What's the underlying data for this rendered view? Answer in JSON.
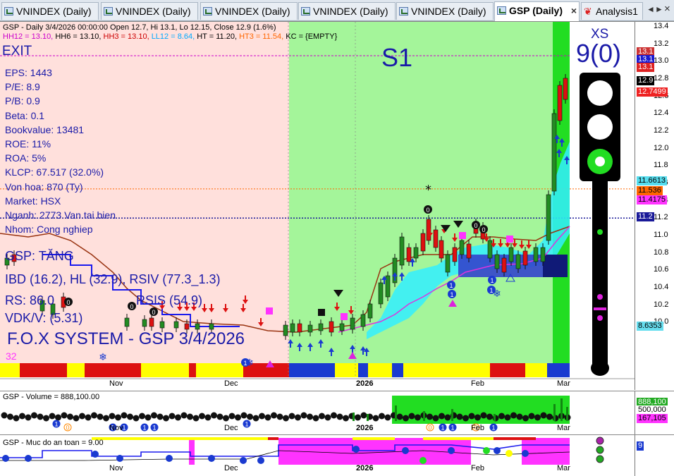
{
  "tabs": [
    {
      "label": "VNINDEX (Daily)",
      "active": false
    },
    {
      "label": "VNINDEX (Daily)",
      "active": false
    },
    {
      "label": "VNINDEX (Daily)",
      "active": false
    },
    {
      "label": "VNINDEX (Daily)",
      "active": false
    },
    {
      "label": "VNINDEX (Daily)",
      "active": false
    },
    {
      "label": "GSP (Daily)",
      "active": true,
      "close": "×"
    },
    {
      "label": "Analysis1",
      "active": false
    }
  ],
  "tab_nav": {
    "prev": "◄",
    "next": "►",
    "close": "×"
  },
  "price_panel": {
    "header_line1": "GSP - Daily 3/4/2026 00:00:00 Open 12.7, Hi 13.1, Lo 12.15, Close 12.9 (1.6%)",
    "header_line2": [
      {
        "text": "HH12 = 13.10,",
        "color": "#cc00cc"
      },
      {
        "text": "HH6 = 13.10,",
        "color": "#000000"
      },
      {
        "text": "HH3 = 13.10,",
        "color": "#cc0000"
      },
      {
        "text": "LL12 = 8.64,",
        "color": "#00aaff"
      },
      {
        "text": "HT = 11.20,",
        "color": "#000000"
      },
      {
        "text": "HT3 = 11.54,",
        "color": "#ff6600"
      },
      {
        "text": "KC = {EMPTY}",
        "color": "#000000"
      }
    ],
    "exit_label": "EXIT",
    "s1_label": "S1",
    "fundamentals": [
      "EPS: 1443",
      "P/E: 8.9",
      "P/B: 0.9",
      "Beta: 0.1",
      "Bookvalue: 13481",
      "ROE: 11%",
      "ROA: 5%",
      "KLCP: 67.517 (32.0%)",
      "Von hoa: 870 (Ty)",
      "Market: HSX",
      "Nganh: 2773 Van tai bien",
      "Nhom: Cong nghiep"
    ],
    "status": "GSP: TĂNG",
    "ibd_line": "IBD (16.2), HL (32.9), RSIV (77.3_1.3)",
    "rs": "RS: 86.0",
    "rsis": "RSIS (54.9)",
    "vdk": "VDK/V:  (5.31)",
    "footer_title": "F.O.X SYSTEM - GSP 3/4/2026",
    "bar_count": "32",
    "xs_label": "XS",
    "score": "9(0)",
    "y_ticks": [
      "13.4",
      "13.2",
      "13.0",
      "12.8",
      "12.6",
      "12.4",
      "12.2",
      "12.0",
      "11.8",
      "11.6",
      "11.4",
      "11.2",
      "11.0",
      "10.8",
      "10.6",
      "10.4",
      "10.2",
      "10.0"
    ],
    "price_tags": [
      {
        "text": "13.1",
        "bg": "#cc3333",
        "fg": "#ffffff",
        "v": 13.12
      },
      {
        "text": "13.1",
        "bg": "#1a1ad0",
        "fg": "#ffffff",
        "v": 13.03
      },
      {
        "text": "13.1",
        "bg": "#dd2222",
        "fg": "#ffffff",
        "v": 12.94
      },
      {
        "text": "12.9",
        "bg": "#000000",
        "fg": "#ffffff",
        "v": 12.78
      },
      {
        "text": "12.7499",
        "bg": "#ee2222",
        "fg": "#ffffff",
        "v": 12.65
      },
      {
        "text": "11.6613",
        "bg": "#55ddee",
        "fg": "#000000",
        "v": 11.63
      },
      {
        "text": "11.536",
        "bg": "#ff6600",
        "fg": "#000000",
        "v": 11.52
      },
      {
        "text": "11.4175",
        "bg": "#ff33ff",
        "fg": "#000000",
        "v": 11.41
      },
      {
        "text": "11.2",
        "bg": "#1a1a99",
        "fg": "#ffffff",
        "v": 11.22
      },
      {
        "text": "8.6353",
        "bg": "#66ddee",
        "fg": "#000000",
        "v": 9.96
      }
    ],
    "x_dates": [
      "Nov",
      "Dec",
      "2026",
      "Feb",
      "Mar"
    ]
  },
  "volume_panel": {
    "header": "GSP - Volume = 888,100.00",
    "tags": [
      {
        "text": "888,100",
        "bg": "#22aa22",
        "fg": "#ffffff"
      },
      {
        "text": "500,000",
        "bg": "#ffffff",
        "fg": "#000000"
      },
      {
        "text": "167,105",
        "bg": "#ff33ff",
        "fg": "#000000"
      }
    ],
    "x_dates": [
      "Nov",
      "Dec",
      "2026",
      "Feb",
      "Mar"
    ]
  },
  "safety_panel": {
    "header": "GSP - Muc do an toan = 9.00",
    "tag": {
      "text": "9",
      "bg": "#1a3ad0",
      "fg": "#ffffff"
    },
    "x_dates": [
      "Nov",
      "Dec",
      "2026",
      "Feb",
      "Mar"
    ]
  },
  "colors": {
    "zone_pink": "#ffe0dc",
    "zone_green": "#a4f59a",
    "bright_green": "#22dd22",
    "info_blue": "#1a1aa8",
    "cyan_band": "#33eeff",
    "candle_green": "#228b22",
    "candle_red": "#dd1111"
  }
}
